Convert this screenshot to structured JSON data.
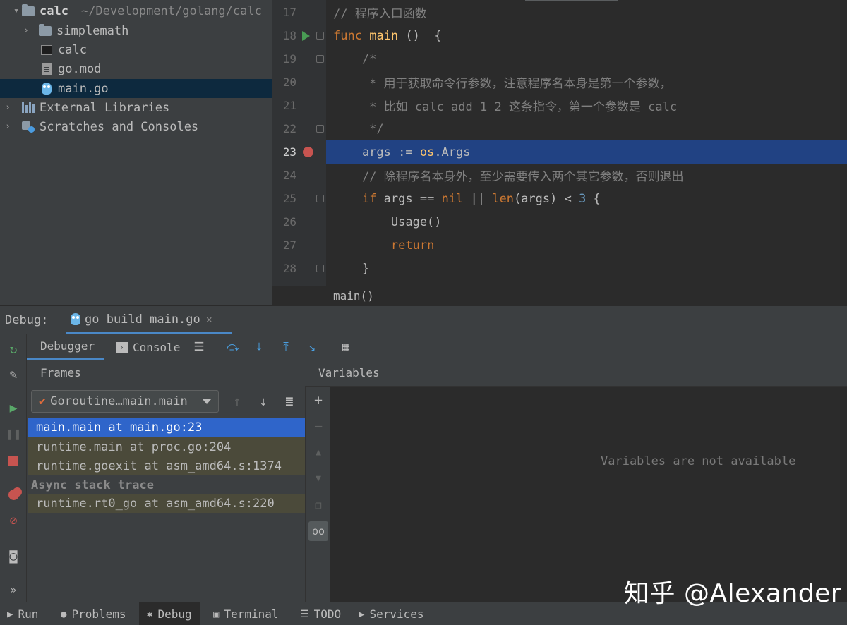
{
  "project": {
    "root": {
      "name": "calc",
      "path": "~/Development/golang/calc"
    },
    "items": [
      {
        "label": "simplemath"
      },
      {
        "label": "calc"
      },
      {
        "label": "go.mod"
      },
      {
        "label": "main.go"
      },
      {
        "label": "External Libraries"
      },
      {
        "label": "Scratches and Consoles"
      }
    ]
  },
  "editor": {
    "lines": [
      {
        "num": "17",
        "code": "// 程序入口函数"
      },
      {
        "num": "18",
        "kw": "func",
        "fn": "main",
        "rest": " ()  {"
      },
      {
        "num": "19",
        "code": "    /*"
      },
      {
        "num": "20",
        "code": "     * 用于获取命令行参数，注意程序名本身是第一个参数，"
      },
      {
        "num": "21",
        "code": "     * 比如 calc add 1 2 这条指令，第一个参数是 calc"
      },
      {
        "num": "22",
        "code": "     */"
      },
      {
        "num": "23",
        "a": "    args := ",
        "b": "os",
        "c": ".Args"
      },
      {
        "num": "24",
        "code": "    // 除程序名本身外，至少需要传入两个其它参数，否则退出"
      },
      {
        "num": "25",
        "p1": "    ",
        "if": "if",
        "p2": " args == ",
        "nil": "nil",
        "p3": " || ",
        "len": "len",
        "p4": "(args) < ",
        "three": "3",
        "p5": " {"
      },
      {
        "num": "26",
        "code": "        Usage()"
      },
      {
        "num": "27",
        "ret": "return"
      },
      {
        "num": "28",
        "code": "    }"
      }
    ],
    "breadcrumb": "main()"
  },
  "debug": {
    "label": "Debug:",
    "session": "go build main.go",
    "close": "×",
    "tabs": {
      "debugger": "Debugger",
      "console": "Console"
    },
    "frames": {
      "title": "Frames",
      "goroutine": "Goroutine…main.main",
      "rows": [
        "main.main at main.go:23",
        "runtime.main at proc.go:204",
        "runtime.goexit at asm_amd64.s:1374"
      ],
      "async_header": "Async stack trace",
      "async_rows": [
        "runtime.rt0_go at asm_amd64.s:220"
      ]
    },
    "variables": {
      "title": "Variables",
      "empty": "Variables are not available"
    }
  },
  "statusbar": {
    "run": "Run",
    "problems": "Problems",
    "debug": "Debug",
    "terminal": "Terminal",
    "todo": "TODO",
    "services": "Services"
  },
  "watermark": "知乎 @Alexander",
  "colors": {
    "selection": "#214283",
    "frame_selected": "#2f65ca",
    "breakpoint": "#c75450",
    "keyword": "#cc7832",
    "function": "#ffc66d",
    "comment": "#808080",
    "number": "#6897bb"
  }
}
